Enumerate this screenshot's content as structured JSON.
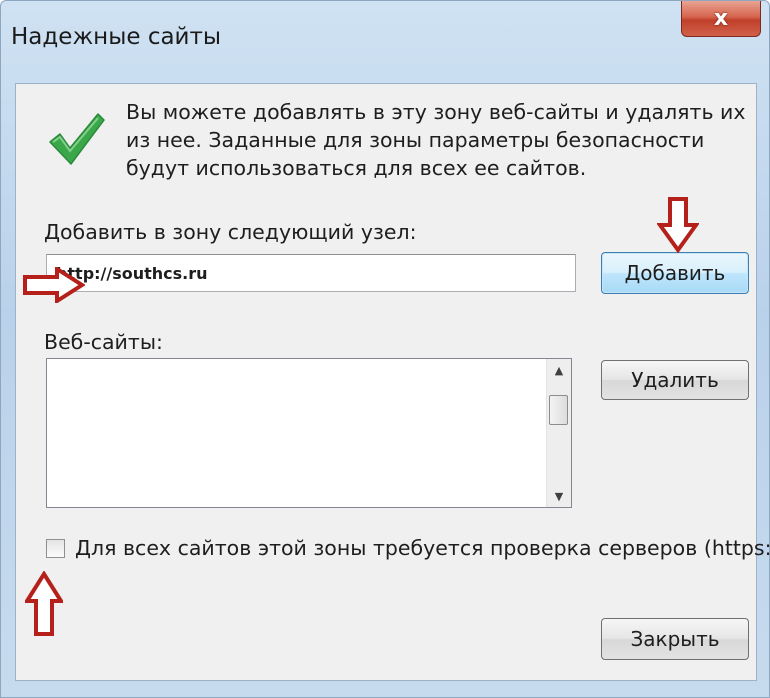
{
  "window": {
    "title": "Надежные сайты",
    "close_glyph": "x"
  },
  "description": "Вы можете добавлять в эту зону  веб-сайты и удалять их из нее. Заданные для зоны параметры безопасности будут использоваться для всех ее сайтов.",
  "add_site": {
    "label": "Добавить в зону следующий узел:",
    "value": "http://southcs.ru",
    "button_label": "Добавить"
  },
  "websites": {
    "label": "Веб-сайты:",
    "items": [],
    "remove_button_label": "Удалить"
  },
  "https_checkbox": {
    "label": "Для всех сайтов этой зоны требуется проверка серверов (https:)",
    "checked": false
  },
  "footer": {
    "close_button_label": "Закрыть"
  },
  "icons": {
    "status": "checkmark-icon",
    "annotation_arrows": [
      "arrow-down-icon",
      "arrow-right-icon",
      "arrow-up-icon"
    ]
  },
  "colors": {
    "check_green": "#3aa84a",
    "annotation_red": "#b5211a",
    "close_button": "#c94a35",
    "primary_button_border": "#3c7fb1"
  }
}
